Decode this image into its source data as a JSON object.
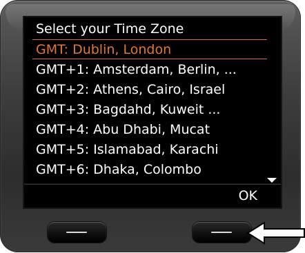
{
  "screen": {
    "title": "Select your Time Zone",
    "items": [
      {
        "label": "GMT: Dublin, London",
        "selected": true
      },
      {
        "label": "GMT+1: Amsterdam, Berlin, ...",
        "selected": false
      },
      {
        "label": "GMT+2: Athens, Cairo, Israel",
        "selected": false
      },
      {
        "label": "GMT+3: Bagdahd, Kuweit ...",
        "selected": false
      },
      {
        "label": "GMT+4: Abu Dhabi, Mucat",
        "selected": false
      },
      {
        "label": "GMT+5: Islamabad, Karachi",
        "selected": false
      },
      {
        "label": "GMT+6: Dhaka, Colombo",
        "selected": false
      }
    ],
    "scroll_indicator_icon": "chevron-down-icon",
    "softkey_right_label": "OK"
  },
  "hardware_keys": {
    "left_icon": "minus-bar-icon",
    "right_icon": "minus-bar-icon"
  },
  "annotation": {
    "pointer_icon": "arrow-left-icon"
  },
  "colors": {
    "background": "#000000",
    "text": "#ffffff",
    "highlight": "#e07832",
    "device_body": "#3e3e3e"
  }
}
